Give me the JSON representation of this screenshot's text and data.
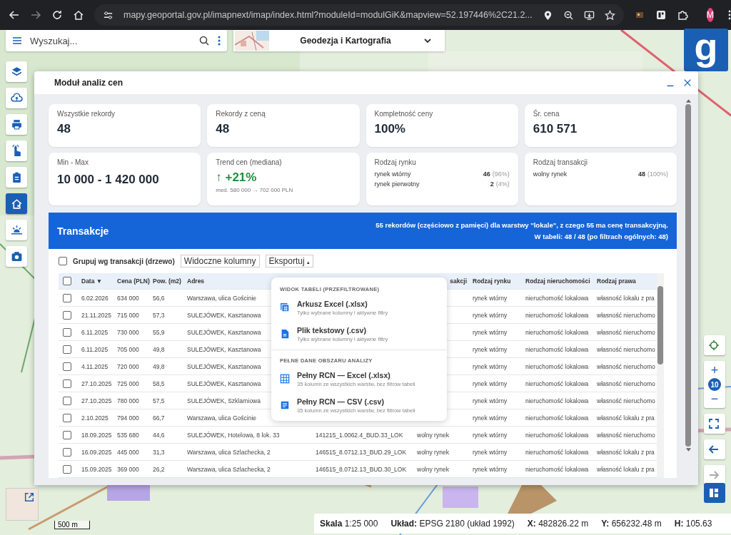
{
  "browser": {
    "url": "mapy.geoportal.gov.pl/imapnext/imap/index.html?moduleId=modulGiK&mapview=52.197446%2C21.2...",
    "avatar": "M"
  },
  "search": {
    "placeholder": "Wyszukaj..."
  },
  "module_selector": {
    "label": "Geodezja i Kartografia"
  },
  "logo": {
    "letter": "g"
  },
  "toolbar": [
    {
      "selected": false
    },
    {
      "selected": false
    },
    {
      "selected": false
    },
    {
      "selected": false
    },
    {
      "selected": false
    },
    {
      "selected": true
    },
    {
      "selected": false
    },
    {
      "selected": false
    }
  ],
  "panel": {
    "title": "Moduł analiz cen",
    "cards": [
      {
        "kind": "stat",
        "label": "Wszystkie rekordy",
        "value": "48"
      },
      {
        "kind": "stat",
        "label": "Rekordy z ceną",
        "value": "48"
      },
      {
        "kind": "stat",
        "label": "Kompletność ceny",
        "value": "100%"
      },
      {
        "kind": "stat",
        "label": "Śr. cena",
        "value": "610 571"
      },
      {
        "kind": "stat",
        "label": "Min - Max",
        "value": "10 000 - 1 420 000"
      },
      {
        "kind": "trend",
        "label": "Trend cen (mediana)",
        "value": "↑ +21%",
        "note": "med. 580 000 → 702 000 PLN"
      },
      {
        "kind": "breakdown",
        "label": "Rodzaj rynku",
        "items": [
          {
            "label": "rynek wtórny",
            "count": "46",
            "pct": "(96%)"
          },
          {
            "label": "rynek pierwotny",
            "count": "2",
            "pct": "(4%)"
          }
        ]
      },
      {
        "kind": "breakdown",
        "label": "Rodzaj transakcji",
        "items": [
          {
            "label": "wolny rynek",
            "count": "48",
            "pct": "(100%)"
          }
        ]
      }
    ],
    "transactions": {
      "title": "Transakcje",
      "summary": "55 rekordów (częściowo z pamięci) dla warstwy \"lokale\", z czego 55 ma cenę transakcyjną.",
      "summary2": "W tabeli: 48 / 48 (po filtrach ogólnych: 48)",
      "group_checkbox": {
        "label": "Grupuj wg transakcji (drzewo)",
        "checked": false
      },
      "select_all_checked": false,
      "columns_button": "Widoczne kolumny",
      "export_button": "Eksportuj",
      "export_caret": "▴",
      "columns": [
        "Data ▼",
        "Cena (PLN)",
        "Pow. (m2)",
        "Adres",
        "sakcji",
        "Rodzaj rynku",
        "Rodzaj nieruchomości",
        "Rodzaj prawa"
      ],
      "rows": [
        {
          "checked": false,
          "date": "6.02.2026",
          "price": "634 000",
          "area": "56,6",
          "address": "Warszawa, ulica Gościnie",
          "market": "rynek wtórny",
          "property": "nieruchomość lokalowa",
          "right": "własność lokalu z pra"
        },
        {
          "checked": false,
          "date": "21.11.2025",
          "price": "715 000",
          "area": "57,3",
          "address": "SULEJÓWEK, Kasztanowa",
          "market": "rynek wtórny",
          "property": "nieruchomość lokalowa",
          "right": "własność nieruchomo"
        },
        {
          "checked": false,
          "date": "6.11.2025",
          "price": "730 000",
          "area": "55,9",
          "address": "SULEJÓWEK, Kasztanowa",
          "market": "rynek wtórny",
          "property": "nieruchomość lokalowa",
          "right": "własność nieruchomo"
        },
        {
          "checked": false,
          "date": "6.11.2025",
          "price": "705 000",
          "area": "49,8",
          "address": "SULEJÓWEK, Kasztanowa",
          "market": "rynek wtórny",
          "property": "nieruchomość lokalowa",
          "right": "własność nieruchomo"
        },
        {
          "checked": false,
          "date": "4.11.2025",
          "price": "720 000",
          "area": "49,8",
          "address": "SULEJÓWEK, Kasztanowa",
          "market": "rynek wtórny",
          "property": "nieruchomość lokalowa",
          "right": "własność nieruchomo"
        },
        {
          "checked": false,
          "date": "27.10.2025",
          "price": "725 000",
          "area": "58,5",
          "address": "SULEJÓWEK, Kasztanowa",
          "market": "rynek wtórny",
          "property": "nieruchomość lokalowa",
          "right": "własność nieruchomo"
        },
        {
          "checked": false,
          "date": "27.10.2025",
          "price": "780 000",
          "area": "57,5",
          "address": "SULEJÓWEK, Szklarniowa",
          "market": "rynek wtórny",
          "property": "nieruchomość lokalowa",
          "right": "własność nieruchomo"
        },
        {
          "checked": false,
          "date": "2.10.2025",
          "price": "794 000",
          "area": "66,7",
          "address": "Warszawa, ulica Gościnie",
          "market": "rynek wtórny",
          "property": "nieruchomość lokalowa",
          "right": "własność lokalu z pra"
        },
        {
          "checked": false,
          "date": "18.09.2025",
          "price": "535 680",
          "area": "44,6",
          "address": "SULEJÓWEK, Hotelowa, 8 lok. 33",
          "id": "141215_1.0062.4_BUD.33_LOK",
          "transaction": "wolny rynek",
          "market": "rynek wtórny",
          "property": "nieruchomość lokalowa",
          "right": "własność nieruchomo"
        },
        {
          "checked": false,
          "date": "16.09.2025",
          "price": "445 000",
          "area": "31,3",
          "address": "Warszawa, ulica Szlachecka, 2",
          "id": "146515_8.0712.13_BUD.29_LOK",
          "transaction": "wolny rynek",
          "market": "rynek wtórny",
          "property": "nieruchomość lokalowa",
          "right": "własność lokalu z pra"
        },
        {
          "checked": false,
          "date": "15.09.2025",
          "price": "369 000",
          "area": "26,2",
          "address": "Warszawa, ulica Szlachecka, 2",
          "id": "146515_8.0712.13_BUD.30_LOK",
          "transaction": "wolny rynek",
          "market": "rynek wtórny",
          "property": "nieruchomość lokalowa",
          "right": "własność lokalu z pra"
        }
      ]
    },
    "export_menu": [
      {
        "title": "WIDOK TABELI (PRZEFILTROWANE)",
        "items": [
          {
            "label": "Arkusz Excel (.xlsx)",
            "note": "Tylko wybrane kolumny i aktywne filtry"
          },
          {
            "label": "Plik tekstowy (.csv)",
            "note": "Tylko wybrane kolumny i aktywne filtry"
          }
        ]
      },
      {
        "title": "PEŁNE DANE OBSZARU ANALIZY",
        "items": [
          {
            "label": "Pełny RCN — Excel (.xlsx)",
            "note": "35 kolumn ze wszystkich warstw, bez filtrów tabeli"
          },
          {
            "label": "Pełny RCN — CSV (.csv)",
            "note": "35 kolumn ze wszystkich warstw, bez filtrów tabeli"
          }
        ]
      }
    ]
  },
  "map_controls": {
    "zoom_level": "10",
    "zoom_in": "+",
    "zoom_out": "−"
  },
  "scale": {
    "label": "500 m"
  },
  "status_bar": [
    {
      "label": "Skala",
      "value": "1:25 000"
    },
    {
      "label": "Układ:",
      "value": "EPSG 2180 (układ 1992)"
    },
    {
      "label": "X:",
      "value": "482826.22 m"
    },
    {
      "label": "Y:",
      "value": "656232.48 m"
    },
    {
      "label": "H:",
      "value": "105.63"
    }
  ]
}
